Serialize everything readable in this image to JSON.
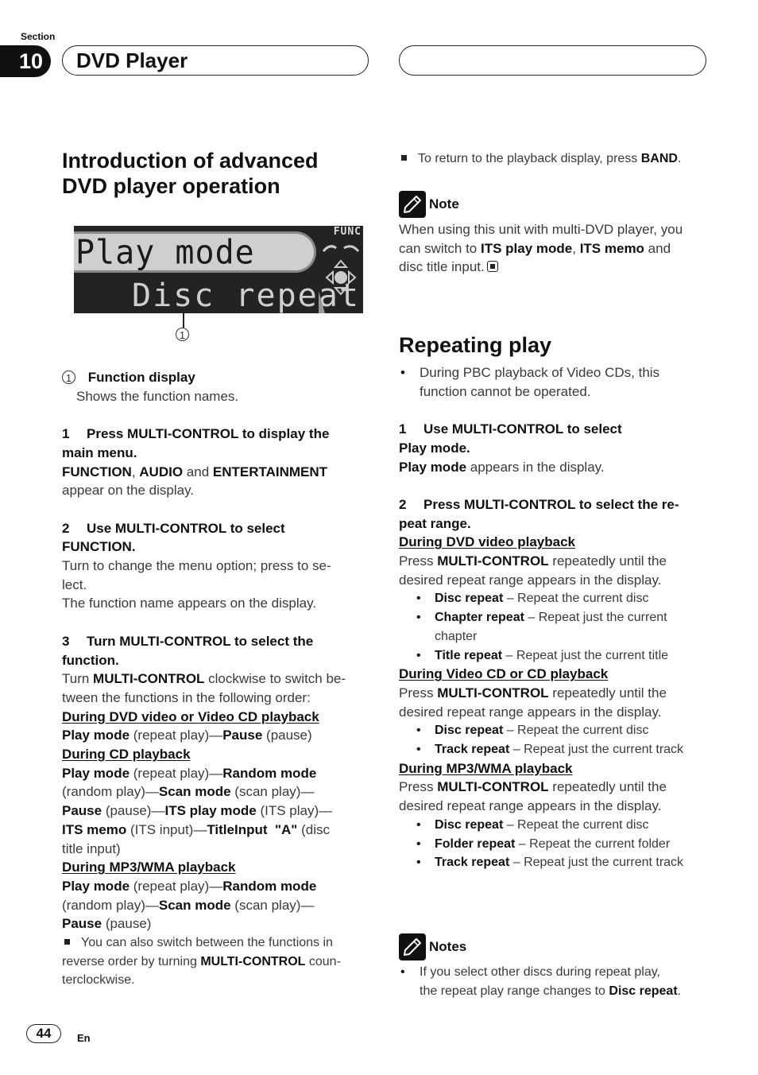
{
  "header": {
    "section_label": "Section",
    "section_number": "10",
    "chapter_title": "DVD Player"
  },
  "left": {
    "title_line1": "Introduction of advanced",
    "title_line2": "DVD player operation",
    "lcd": {
      "line1": "Play mode",
      "line2": "Disc repeat",
      "func_label": "FUNC",
      "callout": "1"
    },
    "legend": {
      "marker": "1",
      "title": "Function display",
      "desc": "Shows the function names."
    },
    "step1": {
      "num": "1",
      "title_a": "Press MULTI-CONTROL to display the",
      "title_b": "main menu.",
      "b1": "FUNCTION",
      "t1": ", ",
      "b2": "AUDIO",
      "t2": " and ",
      "b3": "ENTERTAINMENT",
      "t3": "appear on the display."
    },
    "step2": {
      "num": "2",
      "title_a": "Use MULTI-CONTROL to select",
      "title_b": "FUNCTION.",
      "line1": "Turn to change the menu option; press to se-",
      "line2": "lect.",
      "line3": "The function name appears on the display."
    },
    "step3": {
      "num": "3",
      "title_a": "Turn MULTI-CONTROL to select the",
      "title_b": "function.",
      "t1": "Turn ",
      "b1": "MULTI-CONTROL",
      "t2": " clockwise to switch be-",
      "t3": "tween the functions in the following order:"
    },
    "dvd_heading": "During DVD video or Video CD playback",
    "dvd_seq": {
      "b1": "Play mode",
      "t1": " (repeat play)—",
      "b2": "Pause",
      "t2": " (pause)"
    },
    "cd_heading": "During CD playback",
    "cd_seq": {
      "b1": "Play mode",
      "t1": " (repeat play)—",
      "b2": "Random mode",
      "t2": "(random play)—",
      "b3": "Scan mode",
      "t3": " (scan play)—",
      "b4": "Pause",
      "t4": " (pause)—",
      "b5": "ITS play mode",
      "t5": " (ITS play)—",
      "b6": "ITS memo",
      "t6": " (ITS input)—",
      "b7": "TitleInput  \"A\"",
      "t7": " (disc",
      "t8": "title input)"
    },
    "mp3_heading": "During MP3/WMA playback",
    "mp3_seq": {
      "b1": "Play mode",
      "t1": " (repeat play)—",
      "b2": "Random mode",
      "t2": "(random play)—",
      "b3": "Scan mode",
      "t3": " (scan play)—",
      "b4": "Pause",
      "t4": " (pause)"
    },
    "tip": {
      "t1": "You can also switch between the functions in",
      "t2": "reverse order by turning ",
      "b1": "MULTI-CONTROL",
      "t3": " coun-",
      "t4": "terclockwise."
    }
  },
  "right": {
    "tip_return": {
      "t1": "To return to the playback display, press ",
      "b1": "BAND",
      "t2": "."
    },
    "note": {
      "label": "Note",
      "t1": "When using this unit with multi-DVD player, you",
      "t2": "can switch to ",
      "b1": "ITS play mode",
      "t3": ", ",
      "b2": "ITS memo",
      "t4": " and",
      "t5": "disc title input."
    },
    "title": "Repeating play",
    "pbc_note_a": "During PBC playback of Video CDs, this",
    "pbc_note_b": "function cannot be operated.",
    "step1": {
      "num": "1",
      "title_a": "Use MULTI-CONTROL to select",
      "title_b": "Play mode.",
      "b1": "Play mode",
      "t1": " appears in the display."
    },
    "step2": {
      "num": "2",
      "title_a": "Press MULTI-CONTROL to select the re-",
      "title_b": "peat range."
    },
    "press_text": {
      "t1": "Press ",
      "b1": "MULTI-CONTROL",
      "t2": " repeatedly until the",
      "t3": "desired repeat range appears in the display."
    },
    "dvd_heading": "During DVD video playback",
    "dvd_items": [
      {
        "name": "Disc repeat",
        "desc": " – Repeat the current disc"
      },
      {
        "name": "Chapter repeat",
        "desc": " – Repeat just the current chapter"
      },
      {
        "name": "Title repeat",
        "desc": " – Repeat just the current title"
      }
    ],
    "vcd_heading": "During Video CD or CD playback",
    "vcd_items": [
      {
        "name": "Disc repeat",
        "desc": " – Repeat the current disc"
      },
      {
        "name": "Track repeat",
        "desc": " – Repeat just the current track"
      }
    ],
    "mp3_heading": "During MP3/WMA playback",
    "mp3_items": [
      {
        "name": "Disc repeat",
        "desc": " – Repeat the current disc"
      },
      {
        "name": "Folder repeat",
        "desc": " – Repeat the current folder"
      },
      {
        "name": "Track repeat",
        "desc": " – Repeat just the current track"
      }
    ],
    "notes": {
      "label": "Notes",
      "t1": "If you select other discs during repeat play,",
      "t2": "the repeat play range changes to ",
      "b1": "Disc repeat",
      "t3": "."
    }
  },
  "footer": {
    "page_number": "44",
    "language": "En"
  }
}
